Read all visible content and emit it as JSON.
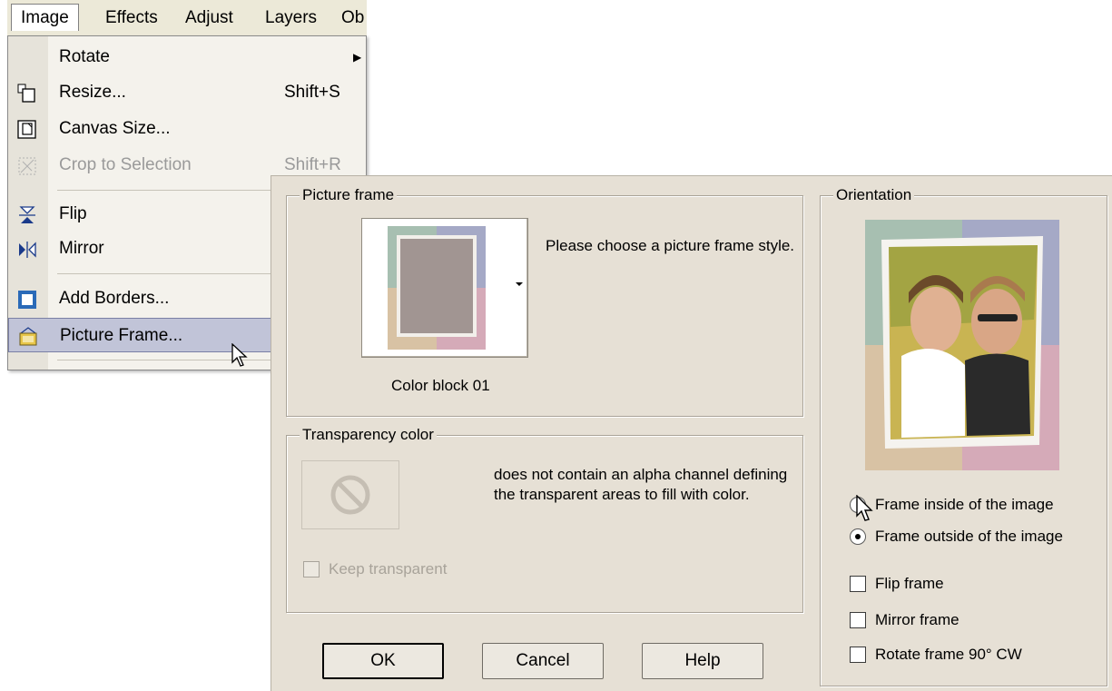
{
  "menubar": {
    "items": [
      "Image",
      "Effects",
      "Adjust",
      "Layers",
      "Ob"
    ]
  },
  "menu": {
    "items": [
      {
        "label": "Rotate",
        "shortcut": "",
        "icon": "none",
        "disabled": false,
        "submenu": true
      },
      {
        "label": "Resize...",
        "shortcut": "Shift+S",
        "icon": "resize-icon",
        "disabled": false
      },
      {
        "label": "Canvas Size...",
        "shortcut": "",
        "icon": "canvas-size-icon",
        "disabled": false
      },
      {
        "label": "Crop to Selection",
        "shortcut": "Shift+R",
        "icon": "crop-icon",
        "disabled": true
      },
      {
        "label": "Flip",
        "shortcut": "",
        "icon": "flip-icon",
        "disabled": false
      },
      {
        "label": "Mirror",
        "shortcut": "",
        "icon": "mirror-icon",
        "disabled": false
      },
      {
        "label": "Add Borders...",
        "shortcut": "",
        "icon": "add-borders-icon",
        "disabled": false
      },
      {
        "label": "Picture Frame...",
        "shortcut": "",
        "icon": "picture-frame-icon",
        "disabled": false,
        "highlighted": true
      }
    ]
  },
  "dialog": {
    "picture_frame": {
      "title": "Picture frame",
      "instruction": "Please choose a picture frame style.",
      "selected_name": "Color block 01"
    },
    "transparency": {
      "title": "Transparency color",
      "message": " does not contain an alpha channel defining the transparent areas to fill with color.",
      "keep_transparent": "Keep transparent",
      "keep_transparent_checked": false
    },
    "orientation": {
      "title": "Orientation",
      "radio_inside": "Frame inside of the image",
      "radio_outside": "Frame outside of the image",
      "selected": "outside",
      "flip_frame": "Flip frame",
      "mirror_frame": "Mirror frame",
      "rotate_frame": "Rotate frame 90° CW",
      "flip_checked": false,
      "mirror_checked": false,
      "rotate_checked": false
    },
    "buttons": {
      "ok": "OK",
      "cancel": "Cancel",
      "help": "Help"
    }
  },
  "colors": {
    "dialog_bg": "#e6e0d5",
    "menu_highlight": "#c1c4d8",
    "frame_sage": "#a7bfb1",
    "frame_lavender": "#a5a9c6",
    "frame_tan": "#d8c2a4",
    "frame_rose": "#d5aab8",
    "frame_center": "#a19592"
  }
}
